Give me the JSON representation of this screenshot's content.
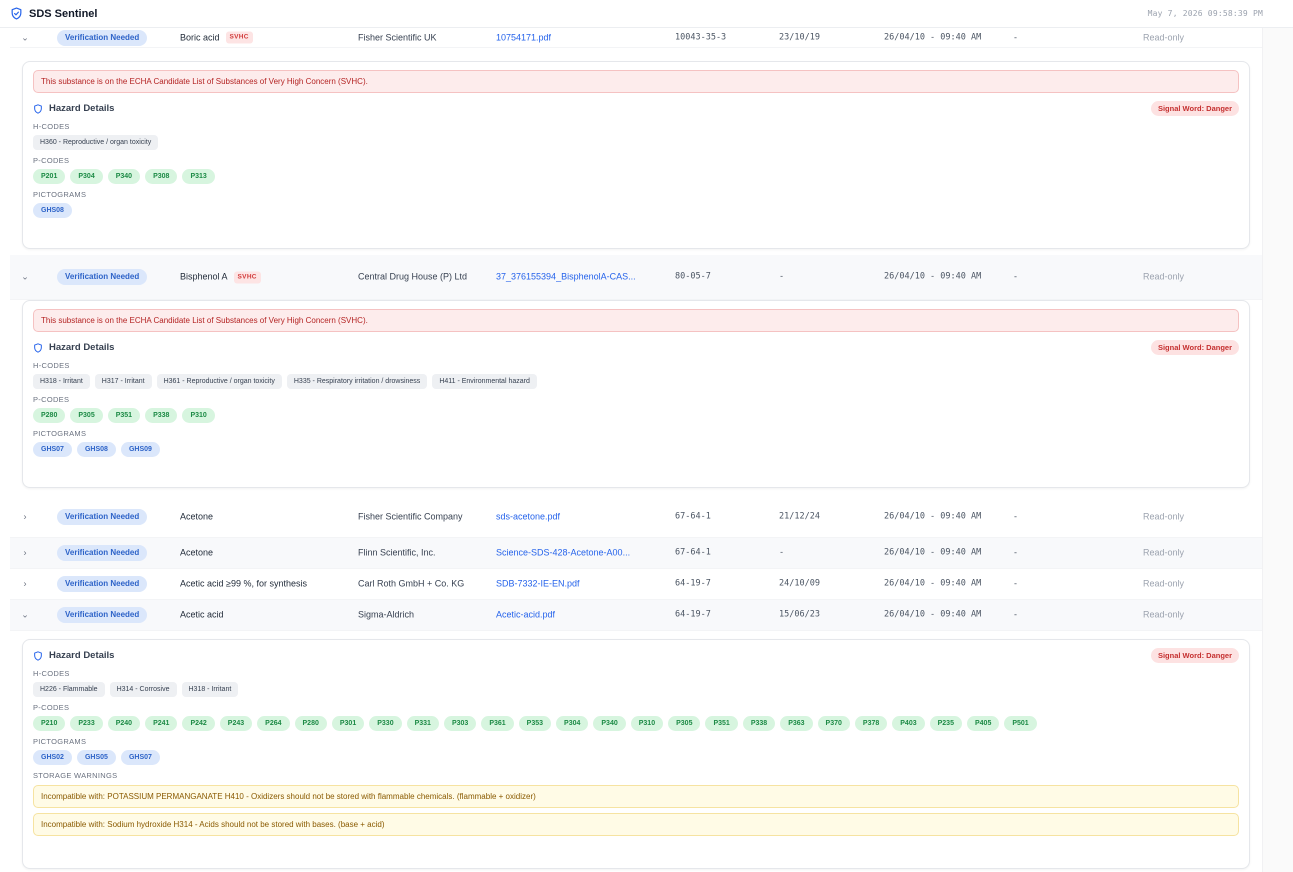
{
  "app": {
    "title": "SDS Sentinel",
    "timestamp": "May 7, 2026 09:58:39 PM"
  },
  "rows": [
    {
      "expanded": true,
      "status": "Verification Needed",
      "name": "Boric acid",
      "svhc": "SVHC",
      "supplier": "Fisher Scientific UK",
      "file": "10754171.pdf",
      "cas": "10043-35-3",
      "date": "23/10/19",
      "timestamp": "26/04/10 - 09:40 AM",
      "extra": "-",
      "access": "Read-only"
    },
    {
      "expanded": true,
      "status": "Verification Needed",
      "name": "Bisphenol A",
      "svhc": "SVHC",
      "supplier": "Central Drug House (P) Ltd",
      "file": "37_376155394_BisphenolA-CAS...",
      "cas": "80-05-7",
      "date": "-",
      "timestamp": "26/04/10 - 09:40 AM",
      "extra": "-",
      "access": "Read-only"
    },
    {
      "expanded": false,
      "status": "Verification Needed",
      "name": "Acetone",
      "svhc": "",
      "supplier": "Fisher Scientific Company",
      "file": "sds-acetone.pdf",
      "cas": "67-64-1",
      "date": "21/12/24",
      "timestamp": "26/04/10 - 09:40 AM",
      "extra": "-",
      "access": "Read-only"
    },
    {
      "expanded": false,
      "status": "Verification Needed",
      "name": "Acetone",
      "svhc": "",
      "supplier": "Flinn Scientific, Inc.",
      "file": "Science-SDS-428-Acetone-A00...",
      "cas": "67-64-1",
      "date": "-",
      "timestamp": "26/04/10 - 09:40 AM",
      "extra": "-",
      "access": "Read-only"
    },
    {
      "expanded": false,
      "status": "Verification Needed",
      "name": "Acetic acid ≥99 %, for synthesis",
      "svhc": "",
      "supplier": "Carl Roth GmbH + Co. KG",
      "file": "SDB-7332-IE-EN.pdf",
      "cas": "64-19-7",
      "date": "24/10/09",
      "timestamp": "26/04/10 - 09:40 AM",
      "extra": "-",
      "access": "Read-only"
    },
    {
      "expanded": true,
      "status": "Verification Needed",
      "name": "Acetic acid",
      "svhc": "",
      "supplier": "Sigma-Aldrich",
      "file": "Acetic-acid.pdf",
      "cas": "64-19-7",
      "date": "15/06/23",
      "timestamp": "26/04/10 - 09:40 AM",
      "extra": "-",
      "access": "Read-only"
    }
  ],
  "panels": [
    {
      "svhc_alert": "This substance is on the ECHA Candidate List of Substances of Very High Concern (SVHC).",
      "title": "Hazard Details",
      "signal": "Signal Word: Danger",
      "labels": {
        "h": "H-CODES",
        "p": "P-CODES",
        "g": "PICTOGRAMS",
        "s": "STORAGE WARNINGS"
      },
      "h_codes": [
        "H360 - Reproductive / organ toxicity"
      ],
      "p_codes": [
        "P201",
        "P304",
        "P340",
        "P308",
        "P313"
      ],
      "pictograms": [
        "GHS08"
      ],
      "warnings": []
    },
    {
      "svhc_alert": "This substance is on the ECHA Candidate List of Substances of Very High Concern (SVHC).",
      "title": "Hazard Details",
      "signal": "Signal Word: Danger",
      "labels": {
        "h": "H-CODES",
        "p": "P-CODES",
        "g": "PICTOGRAMS",
        "s": "STORAGE WARNINGS"
      },
      "h_codes": [
        "H318 - Irritant",
        "H317 - Irritant",
        "H361 - Reproductive / organ toxicity",
        "H335 - Respiratory irritation / drowsiness",
        "H411 - Environmental hazard"
      ],
      "p_codes": [
        "P280",
        "P305",
        "P351",
        "P338",
        "P310"
      ],
      "pictograms": [
        "GHS07",
        "GHS08",
        "GHS09"
      ],
      "warnings": []
    },
    {
      "svhc_alert": "",
      "title": "Hazard Details",
      "signal": "Signal Word: Danger",
      "labels": {
        "h": "H-CODES",
        "p": "P-CODES",
        "g": "PICTOGRAMS",
        "s": "STORAGE WARNINGS"
      },
      "h_codes": [
        "H226 - Flammable",
        "H314 - Corrosive",
        "H318 - Irritant"
      ],
      "p_codes": [
        "P210",
        "P233",
        "P240",
        "P241",
        "P242",
        "P243",
        "P264",
        "P280",
        "P301",
        "P330",
        "P331",
        "P303",
        "P361",
        "P353",
        "P304",
        "P340",
        "P310",
        "P305",
        "P351",
        "P338",
        "P363",
        "P370",
        "P378",
        "P403",
        "P235",
        "P405",
        "P501"
      ],
      "pictograms": [
        "GHS02",
        "GHS05",
        "GHS07"
      ],
      "warnings": [
        "Incompatible with: POTASSIUM PERMANGANATE H410 - Oxidizers should not be stored with flammable chemicals. (flammable + oxidizer)",
        "Incompatible with: Sodium hydroxide H314 - Acids should not be stored with bases. (base + acid)"
      ]
    }
  ]
}
